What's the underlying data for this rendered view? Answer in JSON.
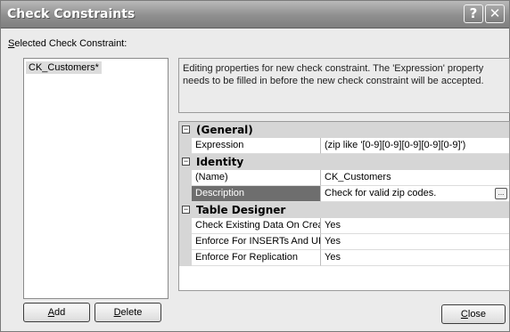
{
  "window": {
    "title": "Check Constraints",
    "help_glyph": "?",
    "close_glyph": "✕"
  },
  "constraint_list": {
    "label_accel": "S",
    "label_rest": "elected Check Constraint:",
    "items": [
      "CK_Customers*"
    ]
  },
  "info_text": "Editing properties for new check constraint.  The 'Expression' property needs to be filled in before the new check constraint will be accepted.",
  "property_grid": {
    "categories": [
      {
        "name": "(General)",
        "toggle": "−",
        "properties": [
          {
            "name": "Expression",
            "value": "(zip like '[0-9][0-9][0-9][0-9][0-9]')"
          }
        ]
      },
      {
        "name": "Identity",
        "toggle": "−",
        "properties": [
          {
            "name": "(Name)",
            "value": "CK_Customers"
          },
          {
            "name": "Description",
            "value": "Check for valid zip codes.",
            "selected": true,
            "button": "..."
          }
        ]
      },
      {
        "name": "Table Designer",
        "toggle": "−",
        "properties": [
          {
            "name": "Check Existing Data On Crea",
            "value": "Yes"
          },
          {
            "name": "Enforce For INSERTs And UF",
            "value": "Yes"
          },
          {
            "name": "Enforce For Replication",
            "value": "Yes"
          }
        ]
      }
    ]
  },
  "buttons": {
    "add_accel": "A",
    "add_rest": "dd",
    "delete_accel": "D",
    "delete_rest": "elete",
    "close_accel": "C",
    "close_rest": "lose"
  },
  "colors": {
    "selected_row": "#6e6e6e",
    "category_bg": "#d6d6d6",
    "dialog_bg": "#ebebeb"
  }
}
